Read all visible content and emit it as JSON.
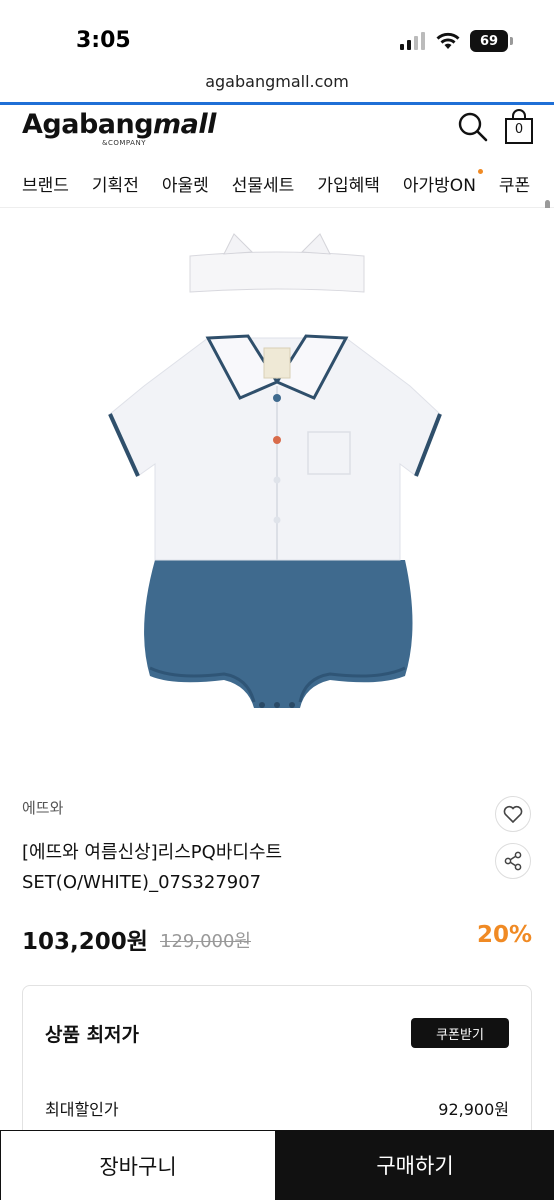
{
  "status": {
    "time": "3:05",
    "battery": "69"
  },
  "browser": {
    "url": "agabangmall.com"
  },
  "header": {
    "logo_main": "Agabang",
    "logo_mall": "mall",
    "logo_sub": "&COMPANY",
    "cart_count": "0"
  },
  "nav": {
    "items": [
      {
        "label": "브랜드"
      },
      {
        "label": "기획전"
      },
      {
        "label": "아울렛"
      },
      {
        "label": "선물세트"
      },
      {
        "label": "가입혜택"
      },
      {
        "label": "아가방ON"
      },
      {
        "label": "쿠폰"
      }
    ]
  },
  "product": {
    "brand": "에뜨와",
    "title": "[에뜨와 여름신상]리스PQ바디수트SET(O/WHITE)_07S327907",
    "price": "103,200원",
    "original_price": "129,000원",
    "discount": "20%"
  },
  "lowest_price": {
    "title": "상품 최저가",
    "coupon_button": "쿠폰받기",
    "max_discount_label": "최대할인가",
    "max_discount_value": "92,900원"
  },
  "bottom": {
    "cart_label": "장바구니",
    "buy_label": "구매하기"
  },
  "colors": {
    "accent": "#f08a24",
    "progress": "#1f6fd6",
    "bodysuit_bottom": "#3f6a8e"
  }
}
